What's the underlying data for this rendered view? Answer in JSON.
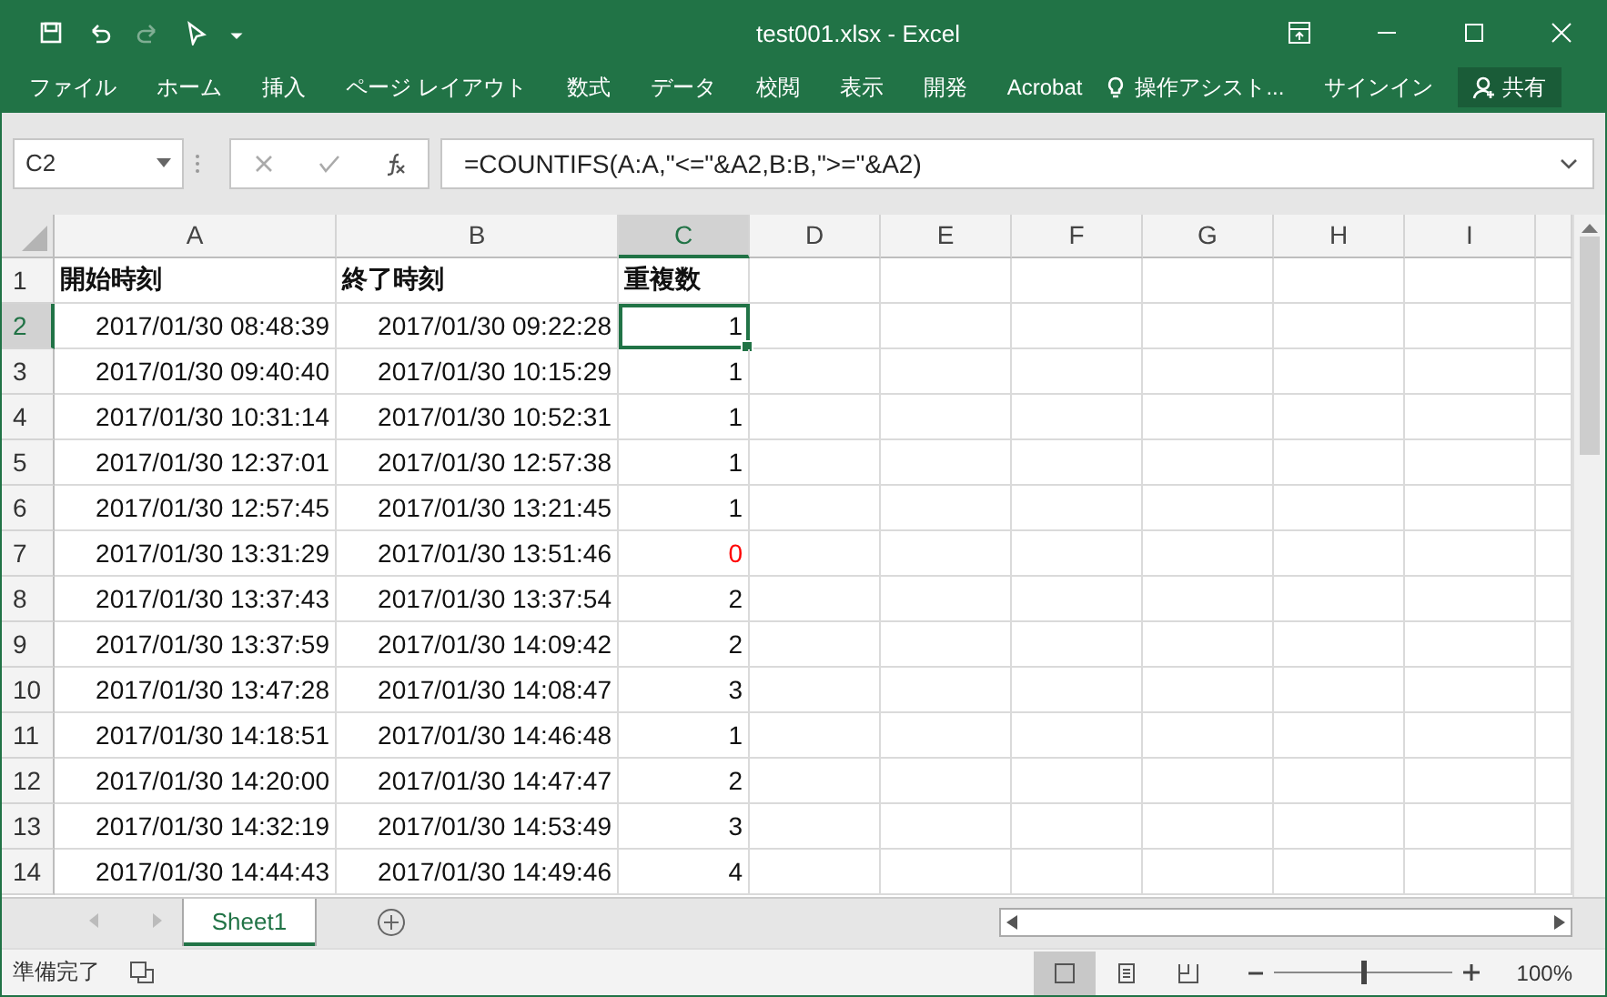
{
  "window": {
    "title": "test001.xlsx - Excel"
  },
  "ribbon": {
    "tabs": [
      "ファイル",
      "ホーム",
      "挿入",
      "ページ レイアウト",
      "数式",
      "データ",
      "校閲",
      "表示",
      "開発",
      "Acrobat"
    ],
    "assist": "操作アシスト...",
    "signin": "サインイン",
    "share": "共有"
  },
  "formula_bar": {
    "name_box": "C2",
    "formula": "=COUNTIFS(A:A,\"<=\"&A2,B:B,\">=\"&A2)"
  },
  "columns": [
    {
      "label": "A",
      "selected": false
    },
    {
      "label": "B",
      "selected": false
    },
    {
      "label": "C",
      "selected": true
    },
    {
      "label": "D",
      "selected": false
    },
    {
      "label": "E",
      "selected": false
    },
    {
      "label": "F",
      "selected": false
    },
    {
      "label": "G",
      "selected": false
    },
    {
      "label": "H",
      "selected": false
    },
    {
      "label": "I",
      "selected": false
    }
  ],
  "header_row": {
    "num": "1",
    "cells": [
      "開始時刻",
      "終了時刻",
      "重複数"
    ]
  },
  "rows": [
    {
      "num": "2",
      "start": "2017/01/30 08:48:39",
      "end": "2017/01/30 09:22:28",
      "count": "1",
      "alert": false,
      "selected": true
    },
    {
      "num": "3",
      "start": "2017/01/30 09:40:40",
      "end": "2017/01/30 10:15:29",
      "count": "1",
      "alert": false,
      "selected": false
    },
    {
      "num": "4",
      "start": "2017/01/30 10:31:14",
      "end": "2017/01/30 10:52:31",
      "count": "1",
      "alert": false,
      "selected": false
    },
    {
      "num": "5",
      "start": "2017/01/30 12:37:01",
      "end": "2017/01/30 12:57:38",
      "count": "1",
      "alert": false,
      "selected": false
    },
    {
      "num": "6",
      "start": "2017/01/30 12:57:45",
      "end": "2017/01/30 13:21:45",
      "count": "1",
      "alert": false,
      "selected": false
    },
    {
      "num": "7",
      "start": "2017/01/30 13:31:29",
      "end": "2017/01/30 13:51:46",
      "count": "0",
      "alert": true,
      "selected": false
    },
    {
      "num": "8",
      "start": "2017/01/30 13:37:43",
      "end": "2017/01/30 13:37:54",
      "count": "2",
      "alert": false,
      "selected": false
    },
    {
      "num": "9",
      "start": "2017/01/30 13:37:59",
      "end": "2017/01/30 14:09:42",
      "count": "2",
      "alert": false,
      "selected": false
    },
    {
      "num": "10",
      "start": "2017/01/30 13:47:28",
      "end": "2017/01/30 14:08:47",
      "count": "3",
      "alert": false,
      "selected": false
    },
    {
      "num": "11",
      "start": "2017/01/30 14:18:51",
      "end": "2017/01/30 14:46:48",
      "count": "1",
      "alert": false,
      "selected": false
    },
    {
      "num": "12",
      "start": "2017/01/30 14:20:00",
      "end": "2017/01/30 14:47:47",
      "count": "2",
      "alert": false,
      "selected": false
    },
    {
      "num": "13",
      "start": "2017/01/30 14:32:19",
      "end": "2017/01/30 14:53:49",
      "count": "3",
      "alert": false,
      "selected": false
    },
    {
      "num": "14",
      "start": "2017/01/30 14:44:43",
      "end": "2017/01/30 14:49:46",
      "count": "4",
      "alert": false,
      "selected": false
    }
  ],
  "sheets": [
    {
      "label": "Sheet1",
      "selected": true
    }
  ],
  "status_bar": {
    "status": "準備完了",
    "views": [
      {
        "kind": "normal",
        "selected": true
      },
      {
        "kind": "layout",
        "selected": false
      },
      {
        "kind": "break",
        "selected": false
      }
    ],
    "zoom": {
      "level": 0.5,
      "reading": "100%"
    }
  }
}
